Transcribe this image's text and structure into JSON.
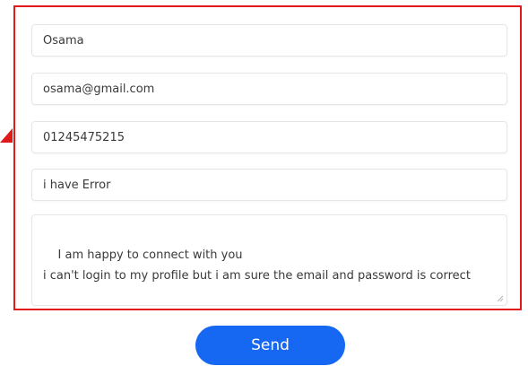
{
  "form": {
    "name_value": "Osama",
    "email_value": "osama@gmail.com",
    "phone_value": "01245475215",
    "subject_value": "i have Error",
    "message_value": "I am happy to connect with you\ni can't login to my profile but i am sure the email and password is correct",
    "send_label": "Send"
  },
  "colors": {
    "highlight_border": "#e0191b",
    "send_button": "#1668f2",
    "field_border": "#e6e6e6"
  },
  "icons": {
    "arrow": "red-arrow-pointer-icon",
    "resize": "textarea-resize-grip-icon"
  }
}
